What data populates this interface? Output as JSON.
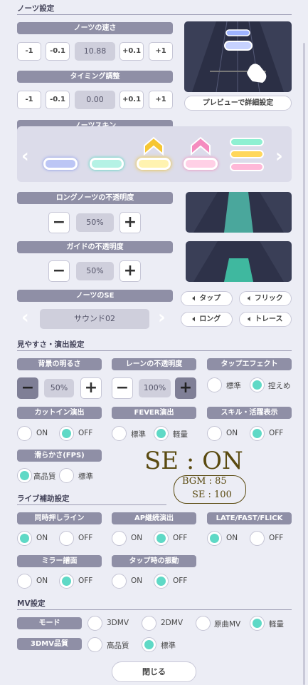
{
  "sections": {
    "notes": "ノーツ設定",
    "visibility": "見やすさ・演出設定",
    "live_support": "ライブ補助設定",
    "mv": "MV設定"
  },
  "note_speed": {
    "label": "ノーツの速さ",
    "minus1": "-1",
    "minus01": "-0.1",
    "value": "10.88",
    "plus01": "+0.1",
    "plus1": "+1"
  },
  "timing": {
    "label": "タイミング調整",
    "minus1": "-1",
    "minus01": "-0.1",
    "value": "0.00",
    "plus01": "+0.1",
    "plus1": "+1"
  },
  "preview_button": "プレビューで詳細設定",
  "note_skin": {
    "label": "ノーツスキン"
  },
  "long_opacity": {
    "label": "ロングノーツの不透明度",
    "minus": "−",
    "value": "50%",
    "plus": "+"
  },
  "guide_opacity": {
    "label": "ガイドの不透明度",
    "minus": "−",
    "value": "50%",
    "plus": "+"
  },
  "note_se": {
    "label": "ノーツのSE",
    "sound": "サウンド02",
    "tap": "タップ",
    "flick": "フリック",
    "long": "ロング",
    "trace": "トレース"
  },
  "bg_brightness": {
    "label": "背景の明るさ",
    "minus": "−",
    "value": "50%",
    "plus": "+"
  },
  "lane_opacity": {
    "label": "レーンの不透明度",
    "minus": "−",
    "value": "100%",
    "plus": "+"
  },
  "tap_effect": {
    "label": "タップエフェクト",
    "opt1": "標準",
    "opt2": "控えめ",
    "selected": "控えめ"
  },
  "cutin": {
    "label": "カットイン演出",
    "opt1": "ON",
    "opt2": "OFF",
    "selected": "OFF"
  },
  "fever": {
    "label": "FEVER演出",
    "opt1": "標準",
    "opt2": "軽量",
    "selected": "軽量"
  },
  "skill": {
    "label": "スキル・活躍表示",
    "opt1": "ON",
    "opt2": "OFF",
    "selected": "OFF"
  },
  "fps": {
    "label": "滑らかさ(FPS)",
    "opt1": "高品質",
    "opt2": "標準",
    "selected": "高品質"
  },
  "handwriting": {
    "line1": "SE : ON",
    "line2": "BGM : 85",
    "line3": "SE : 100"
  },
  "simul_line": {
    "label": "同時押しライン",
    "opt1": "ON",
    "opt2": "OFF",
    "selected": "ON"
  },
  "ap_effect": {
    "label": "AP継続演出",
    "opt1": "ON",
    "opt2": "OFF",
    "selected": "OFF"
  },
  "late_fast": {
    "label": "LATE/FAST/FLICK",
    "opt1": "ON",
    "opt2": "OFF",
    "selected": "ON"
  },
  "mirror": {
    "label": "ミラー譜面",
    "opt1": "ON",
    "opt2": "OFF",
    "selected": "OFF"
  },
  "vibration": {
    "label": "タップ時の振動",
    "opt1": "ON",
    "opt2": "OFF",
    "selected": "OFF"
  },
  "mode": {
    "label": "モード",
    "opt1": "3DMV",
    "opt2": "2DMV",
    "opt3": "原曲MV",
    "opt4": "軽量",
    "selected": "軽量"
  },
  "mv_quality": {
    "label": "3DMV品質",
    "opt1": "高品質",
    "opt2": "標準",
    "selected": "標準"
  },
  "close_button": "閉じる",
  "colors": {
    "accent": "#5fd9c6",
    "pill": "#8f8fa6",
    "background": "#ecedf5"
  }
}
